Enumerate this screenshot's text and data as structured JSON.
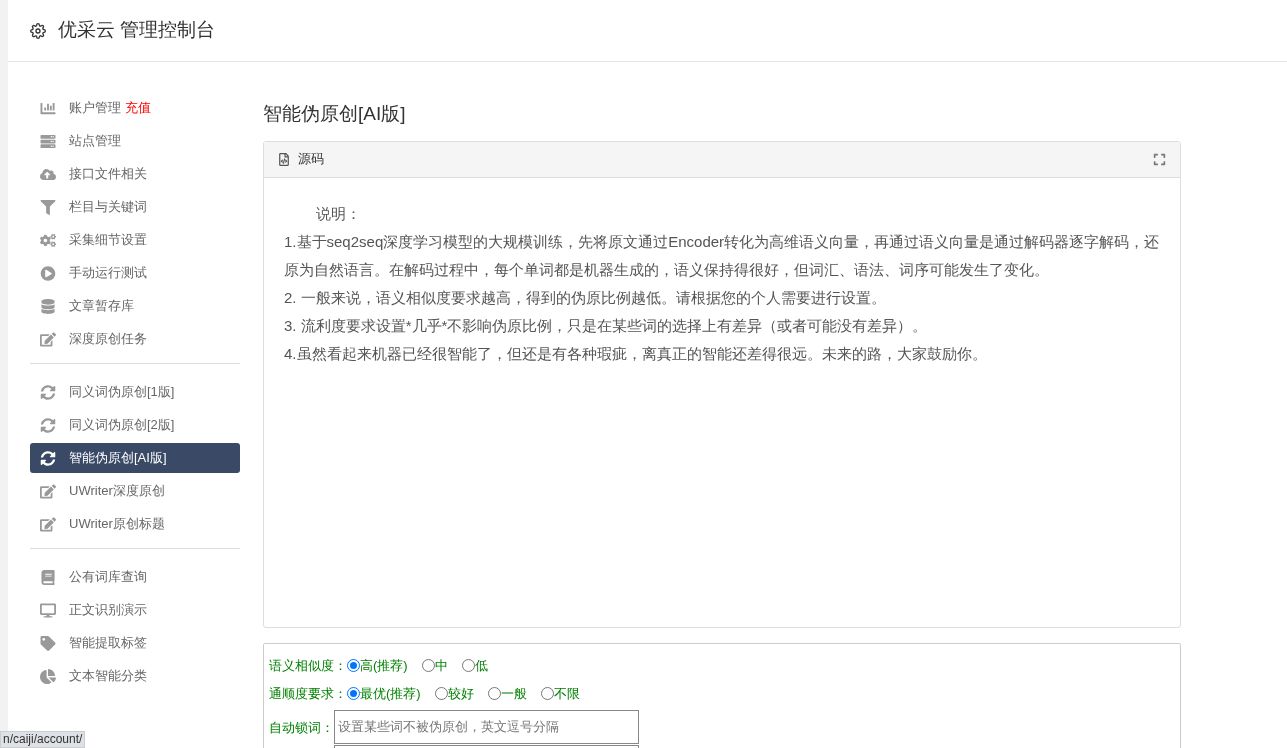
{
  "header": {
    "title": "优采云 管理控制台"
  },
  "sidebar": {
    "groups": [
      {
        "items": [
          {
            "label": "账户管理",
            "badge": "充值",
            "selected": false
          },
          {
            "label": "站点管理",
            "selected": false
          },
          {
            "label": "接口文件相关",
            "selected": false
          },
          {
            "label": "栏目与关键词",
            "selected": false
          },
          {
            "label": "采集细节设置",
            "selected": false
          },
          {
            "label": "手动运行测试",
            "selected": false
          },
          {
            "label": "文章暂存库",
            "selected": false
          },
          {
            "label": "深度原创任务",
            "selected": false
          }
        ]
      },
      {
        "items": [
          {
            "label": "同义词伪原创[1版]",
            "selected": false
          },
          {
            "label": "同义词伪原创[2版]",
            "selected": false
          },
          {
            "label": "智能伪原创[AI版]",
            "selected": true
          },
          {
            "label": "UWriter深度原创",
            "selected": false
          },
          {
            "label": "UWriter原创标题",
            "selected": false
          }
        ]
      },
      {
        "items": [
          {
            "label": "公有词库查询",
            "selected": false
          },
          {
            "label": "正文识别演示",
            "selected": false
          },
          {
            "label": "智能提取标签",
            "selected": false
          },
          {
            "label": "文本智能分类",
            "selected": false
          }
        ]
      }
    ]
  },
  "page": {
    "title": "智能伪原创[AI版]",
    "editor": {
      "tab": "源码",
      "lines": [
        "说明：",
        "1.基于seq2seq深度学习模型的大规模训练，先将原文通过Encoder转化为高维语义向量，再通过语义向量是通过解码器逐字解码，还原为自然语言。在解码过程中，每个单词都是机器生成的，语义保持得很好，但词汇、语法、词序可能发生了变化。",
        "2. 一般来说，语义相似度要求越高，得到的伪原比例越低。请根据您的个人需要进行设置。",
        "3. 流利度要求设置*几乎*不影响伪原比例，只是在某些词的选择上有差异（或者可能没有差异）。",
        "4.虽然看起来机器已经很智能了，但还是有各种瑕疵，离真正的智能还差得很远。未来的路，大家鼓励你。"
      ]
    },
    "options": [
      {
        "label": "语义相似度：",
        "choices": [
          {
            "label": "高(推荐)",
            "selected": true
          },
          {
            "label": "中",
            "selected": false
          },
          {
            "label": "低",
            "selected": false
          }
        ]
      },
      {
        "label": "通顺度要求：",
        "choices": [
          {
            "label": "最优(推荐)",
            "selected": true
          },
          {
            "label": "较好",
            "selected": false
          },
          {
            "label": "一般",
            "selected": false
          },
          {
            "label": "不限",
            "selected": false
          }
        ]
      }
    ],
    "lock_words": {
      "label": "自动锁词：",
      "placeholder": "设置某些词不被伪原创，英文逗号分隔"
    }
  },
  "status_bar": {
    "url": "n/caiji/account/"
  }
}
